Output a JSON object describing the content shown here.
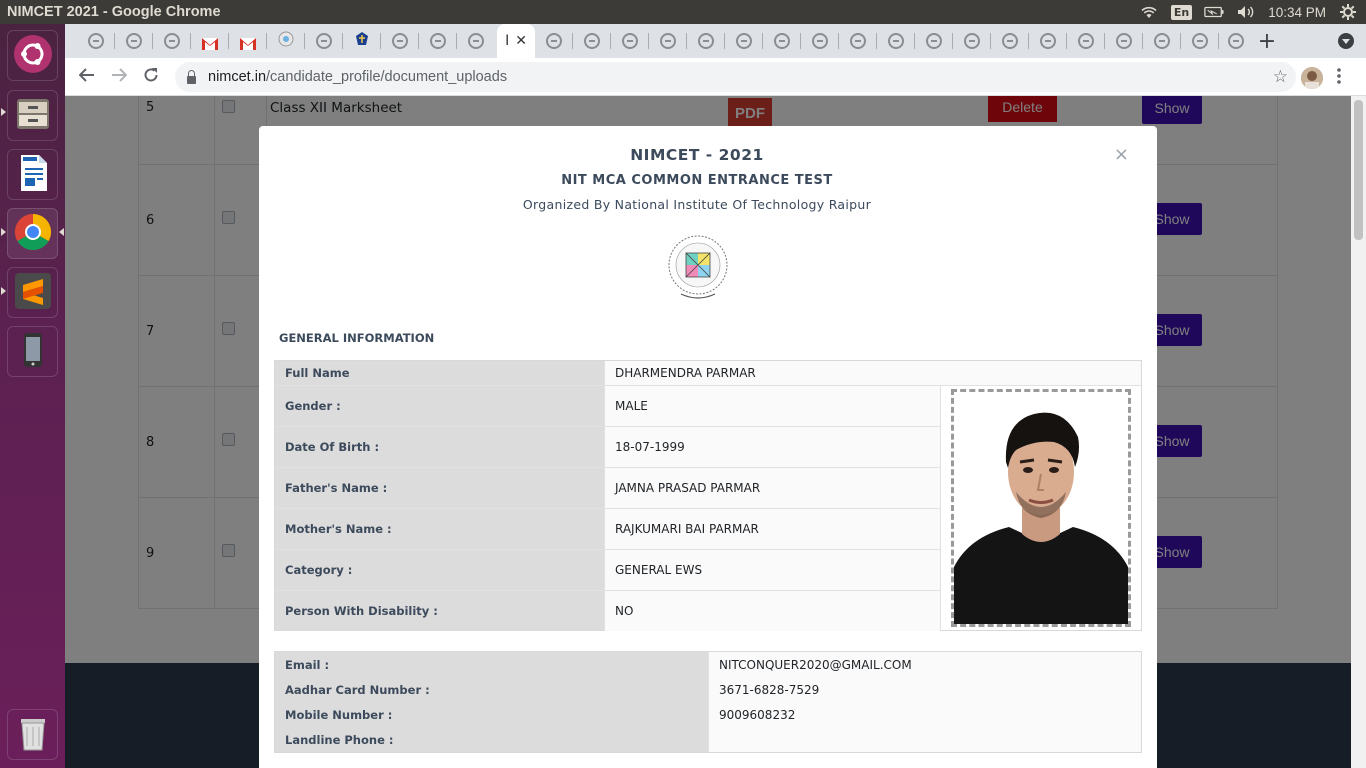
{
  "window": {
    "title": "NIMCET 2021 - Google Chrome"
  },
  "system": {
    "language": "En",
    "time": "10:34 PM"
  },
  "launcher": {
    "items": [
      {
        "name": "ubuntu-dash"
      },
      {
        "name": "files"
      },
      {
        "name": "libreoffice-writer"
      },
      {
        "name": "google-chrome"
      },
      {
        "name": "sublime-text"
      },
      {
        "name": "android-device"
      },
      {
        "name": "trash"
      }
    ]
  },
  "browser": {
    "active_tab_label": "I",
    "url_host": "nimcet.in",
    "url_path": "/candidate_profile/document_uploads"
  },
  "background_table": {
    "rows": [
      {
        "num": "5",
        "doc": "Class XII Marksheet",
        "pdf_label": "PDF",
        "delete_label": "Delete",
        "show_label": "Show"
      },
      {
        "num": "6",
        "show_label": "Show"
      },
      {
        "num": "7",
        "show_label": "Show"
      },
      {
        "num": "8",
        "show_label": "Show"
      },
      {
        "num": "9",
        "show_label": "Show"
      }
    ]
  },
  "modal": {
    "close": "×",
    "title": "NIMCET - 2021",
    "subtitle": "NIT MCA COMMON ENTRANCE TEST",
    "organizer": "Organized By National Institute Of Technology Raipur",
    "section_heading": "GENERAL INFORMATION",
    "general_info": [
      {
        "label": "Full Name",
        "value": "DHARMENDRA PARMAR"
      },
      {
        "label": "Gender :",
        "value": "MALE"
      },
      {
        "label": "Date Of Birth :",
        "value": "18-07-1999"
      },
      {
        "label": "Father's Name :",
        "value": "JAMNA PRASAD PARMAR"
      },
      {
        "label": "Mother's Name :",
        "value": "RAJKUMARI BAI PARMAR"
      },
      {
        "label": "Category :",
        "value": "GENERAL EWS"
      },
      {
        "label": "Person With Disability :",
        "value": "NO"
      }
    ],
    "contact_info": [
      {
        "label": "Email :",
        "value": "NITCONQUER2020@GMAIL.COM"
      },
      {
        "label": "Aadhar Card Number :",
        "value": "3671-6828-7529"
      },
      {
        "label": "Mobile Number :",
        "value": "9009608232"
      },
      {
        "label": "Landline Phone :",
        "value": ""
      }
    ]
  },
  "colors": {
    "launcher": "#5b2150",
    "show_button": "#3f0fb4",
    "delete_button": "#dc0a14",
    "label_bg": "#dcdcdc",
    "heading_text": "#3c4a5c"
  }
}
